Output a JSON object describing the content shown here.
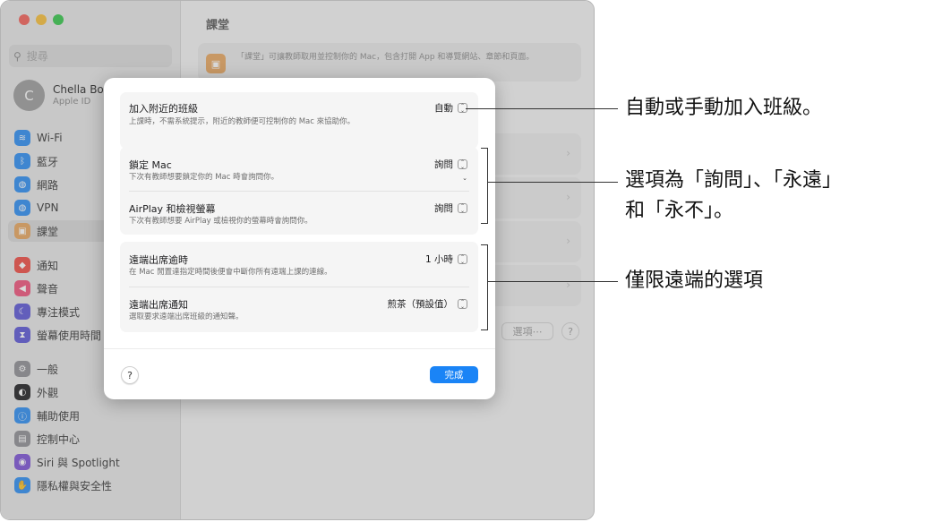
{
  "window": {
    "title": "課堂"
  },
  "sidebar": {
    "search_placeholder": "搜尋",
    "account": {
      "initial": "C",
      "name": "Chella Boe",
      "subtitle": "Apple ID"
    },
    "items": [
      {
        "label": "Wi‑Fi",
        "icon": "wifi-icon",
        "color": "#2a8cf3"
      },
      {
        "label": "藍牙",
        "icon": "bluetooth-icon",
        "color": "#2a8cf3"
      },
      {
        "label": "網路",
        "icon": "globe-icon",
        "color": "#2a8cf3"
      },
      {
        "label": "VPN",
        "icon": "vpn-icon",
        "color": "#2a8cf3"
      },
      {
        "label": "課堂",
        "icon": "classroom-icon",
        "color": "#e8a55e",
        "selected": true
      },
      {
        "label": "通知",
        "icon": "bell-icon",
        "color": "#f04a42"
      },
      {
        "label": "聲音",
        "icon": "speaker-icon",
        "color": "#f0517a"
      },
      {
        "label": "專注模式",
        "icon": "moon-icon",
        "color": "#5a55d6"
      },
      {
        "label": "螢幕使用時間",
        "icon": "hourglass-icon",
        "color": "#5a55d6"
      },
      {
        "label": "一般",
        "icon": "gear-icon",
        "color": "#8e8e93"
      },
      {
        "label": "外觀",
        "icon": "appearance-icon",
        "color": "#1d1d1f"
      },
      {
        "label": "輔助使用",
        "icon": "accessibility-icon",
        "color": "#2a8cf3"
      },
      {
        "label": "控制中心",
        "icon": "control-center-icon",
        "color": "#8e8e93"
      },
      {
        "label": "Siri 與 Spotlight",
        "icon": "siri-icon",
        "color": "#7a4fd6"
      },
      {
        "label": "隱私權與安全性",
        "icon": "hand-icon",
        "color": "#2a8cf3"
      }
    ]
  },
  "content": {
    "banner_text": "「課堂」可讓教師取用並控制你的 Mac，包含打開 App 和導覽網站、章節和頁面。",
    "options_button": "選項⋯",
    "help_button": "?"
  },
  "sheet": {
    "group1": {
      "title": "加入附近的班級",
      "desc": "上課時，不需系統提示，附近的教師便可控制你的 Mac 來協助你。",
      "value": "自動"
    },
    "group2": [
      {
        "title": "鎖定 Mac",
        "desc": "下次有教師想要鎖定你的 Mac 時會詢問你。",
        "value": "詢問"
      },
      {
        "title": "AirPlay 和檢視螢幕",
        "desc": "下次有教師想要 AirPlay 或檢視你的螢幕時會詢問你。",
        "value": "詢問"
      }
    ],
    "group3": [
      {
        "title": "遠端出席逾時",
        "desc": "在 Mac 閒置達指定時間後便會中斷你所有遠端上課的連線。",
        "value": "1 小時"
      },
      {
        "title": "遠端出席通知",
        "desc": "選取要求遠端出席班級的通知聲。",
        "value": "煎茶（預設值）"
      }
    ],
    "help_button": "?",
    "done_button": "完成"
  },
  "callouts": {
    "auto_manual": "自動或手動加入班級。",
    "options_line1": "選項為「詢問」、「永遠」",
    "options_line2": "和「永不」。",
    "remote_only": "僅限遠端的選項"
  }
}
